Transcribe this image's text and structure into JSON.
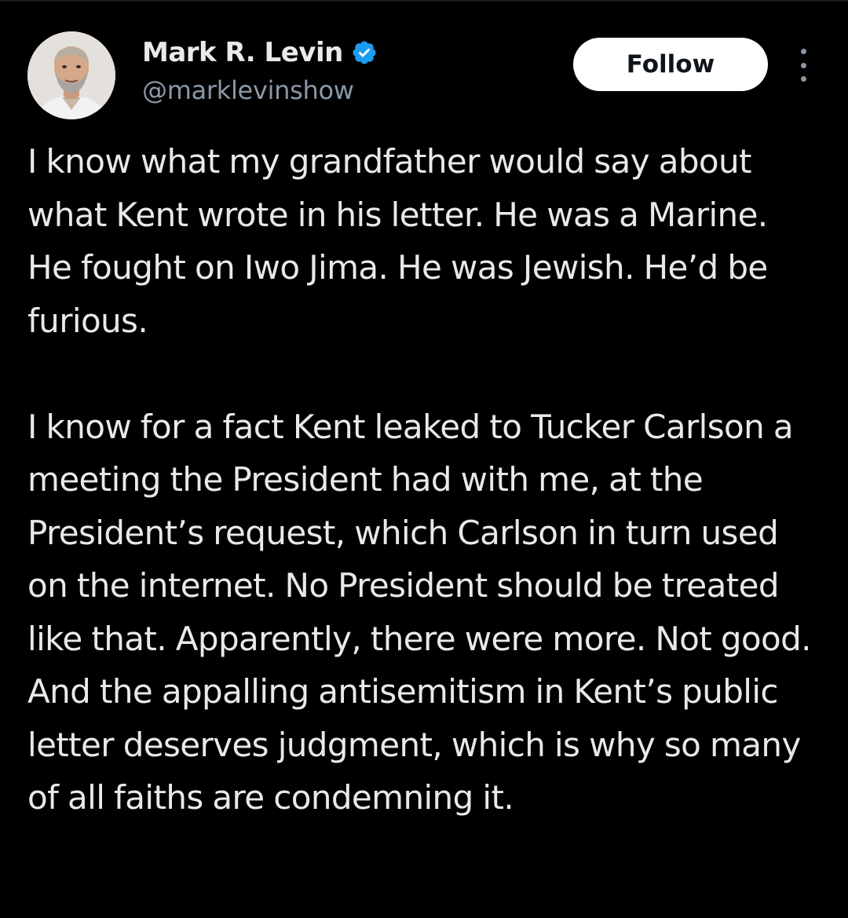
{
  "author": {
    "display_name": "Mark R. Levin",
    "handle": "@marklevinshow",
    "verified": true,
    "verified_icon": "verified-badge-icon",
    "verified_color": "#1d9bf0"
  },
  "actions": {
    "follow_label": "Follow",
    "more_icon": "more-options-icon"
  },
  "tweet": {
    "paragraphs": [
      "I know what my grandfather would say about what Kent wrote in his letter. He was a Marine. He fought on Iwo Jima.  He was Jewish. He’d be furious.",
      "I know for a fact Kent leaked to Tucker Carlson a meeting the President had with me, at the President’s request, which Carlson in turn used on the internet.  No President should be treated like that. Apparently, there were more. Not good. And the appalling antisemitism in Kent’s public letter deserves judgment, which is why so many of all faiths are condemning it."
    ]
  },
  "colors": {
    "background": "#000000",
    "text_primary": "#e7e9ea",
    "text_secondary": "#8b98a5",
    "follow_bg": "#ffffff",
    "follow_text": "#0f1419"
  }
}
